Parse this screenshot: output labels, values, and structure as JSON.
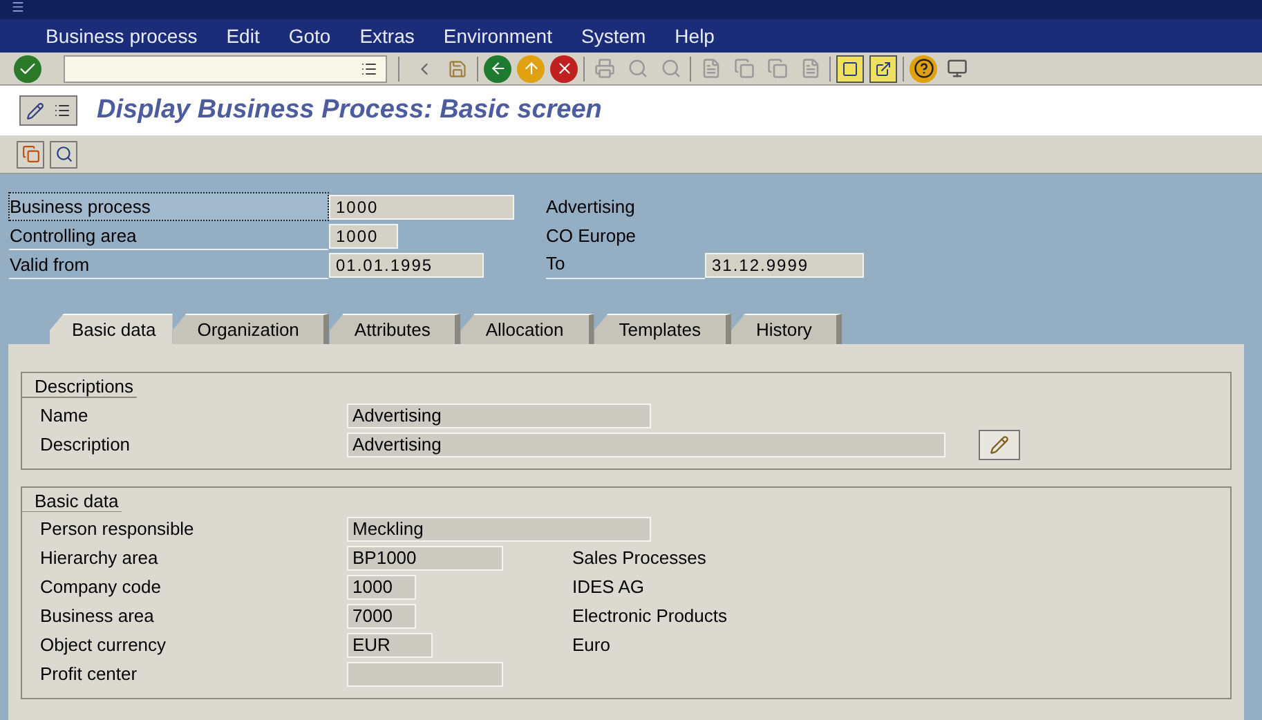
{
  "menu_bar": [
    {
      "label": "Business process"
    },
    {
      "label": "Edit"
    },
    {
      "label": "Goto"
    },
    {
      "label": "Extras"
    },
    {
      "label": "Environment"
    },
    {
      "label": "System"
    },
    {
      "label": "Help"
    }
  ],
  "screen_title": "Display Business Process: Basic screen",
  "header_fields": [
    {
      "label": "Business process",
      "value": "1000",
      "description": "Advertising",
      "focused": true
    },
    {
      "label": "Controlling area",
      "value": "1000",
      "description": "CO Europe",
      "focused": false
    },
    {
      "label": "Valid from",
      "value": "01.01.1995",
      "to_label": "To",
      "to_value": "31.12.9999",
      "focused": false
    }
  ],
  "tabs": [
    {
      "label": "Basic data",
      "selected": true
    },
    {
      "label": "Organization",
      "selected": false
    },
    {
      "label": "Attributes",
      "selected": false
    },
    {
      "label": "Allocation",
      "selected": false
    },
    {
      "label": "Templates",
      "selected": false
    },
    {
      "label": "History",
      "selected": false
    }
  ],
  "groups": [
    {
      "title": "Descriptions",
      "fields": [
        {
          "label": "Name",
          "value": "Advertising"
        },
        {
          "label": "Description",
          "value": "Advertising"
        }
      ]
    },
    {
      "title": "Basic data",
      "fields": [
        {
          "label": "Person responsible",
          "value": "Meckling"
        },
        {
          "label": "Hierarchy area",
          "value": "BP1000",
          "description": "Sales Processes"
        },
        {
          "label": "Company code",
          "value": "1000",
          "description": "IDES AG"
        },
        {
          "label": "Business area",
          "value": "7000",
          "description": "Electronic Products"
        },
        {
          "label": "Object currency",
          "value": "EUR",
          "description": "Euro"
        },
        {
          "label": "Profit center"
        }
      ]
    }
  ]
}
